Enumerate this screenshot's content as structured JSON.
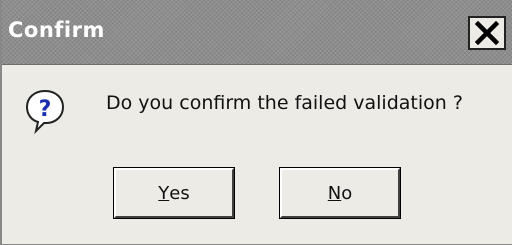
{
  "dialog": {
    "title": "Confirm",
    "message": "Do you confirm the failed validation ?",
    "buttons": {
      "yes": {
        "label_accesskey": "Y",
        "label_rest": "es"
      },
      "no": {
        "label_accesskey": "N",
        "label_rest": "o"
      }
    }
  },
  "icons": {
    "dialog_icon": "question-icon",
    "close": "close-icon"
  },
  "colors": {
    "titlebar": "#8e8e8e",
    "background": "#ecebe6",
    "question_mark": "#1a2fb0"
  }
}
